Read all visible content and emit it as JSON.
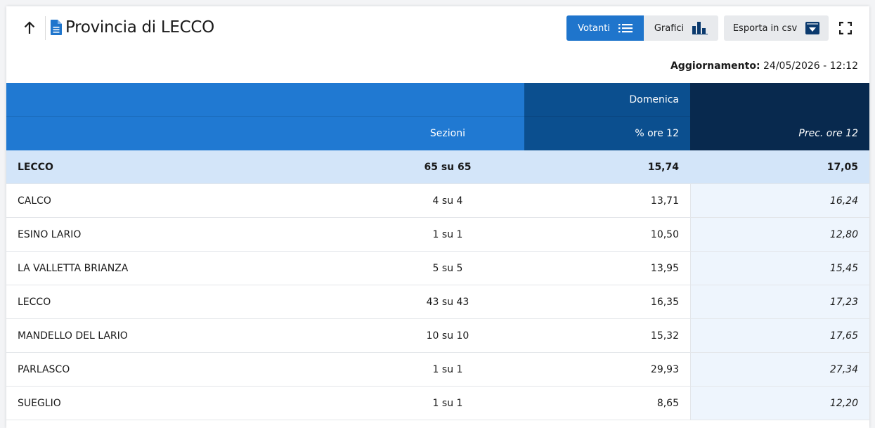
{
  "header": {
    "title": "Provincia di LECCO",
    "votanti_label": "Votanti",
    "grafici_label": "Grafici",
    "csv_label": "Esporta in csv"
  },
  "update": {
    "label": "Aggiornamento:",
    "value": "24/05/2026 - 12:12"
  },
  "table": {
    "group_header": "Domenica",
    "col_sezioni": "Sezioni",
    "col_pct": "% ore 12",
    "col_prec": "Prec. ore 12",
    "total": {
      "name": "LECCO",
      "sezioni": "65 su 65",
      "pct": "15,74",
      "prec": "17,05"
    },
    "rows": [
      {
        "name": "CALCO",
        "sezioni": "4 su 4",
        "pct": "13,71",
        "prec": "16,24"
      },
      {
        "name": "ESINO LARIO",
        "sezioni": "1 su 1",
        "pct": "10,50",
        "prec": "12,80"
      },
      {
        "name": "LA VALLETTA BRIANZA",
        "sezioni": "5 su 5",
        "pct": "13,95",
        "prec": "15,45"
      },
      {
        "name": "LECCO",
        "sezioni": "43 su 43",
        "pct": "16,35",
        "prec": "17,23"
      },
      {
        "name": "MANDELLO DEL LARIO",
        "sezioni": "10 su 10",
        "pct": "15,32",
        "prec": "17,65"
      },
      {
        "name": "PARLASCO",
        "sezioni": "1 su 1",
        "pct": "29,93",
        "prec": "27,34"
      },
      {
        "name": "SUEGLIO",
        "sezioni": "1 su 1",
        "pct": "8,65",
        "prec": "12,20"
      }
    ]
  },
  "icons": {
    "back": "arrow-up-icon",
    "document": "document-icon",
    "list": "list-icon",
    "chart": "bar-chart-icon",
    "download": "download-icon",
    "fullscreen": "fullscreen-icon"
  },
  "colors": {
    "primary": "#1f75cc",
    "header_blue": "#2079d2",
    "header_mid": "#0b4f8f",
    "header_dark": "#08294e",
    "total_row": "#d3e5f9",
    "prec_col": "#eef5fd"
  }
}
